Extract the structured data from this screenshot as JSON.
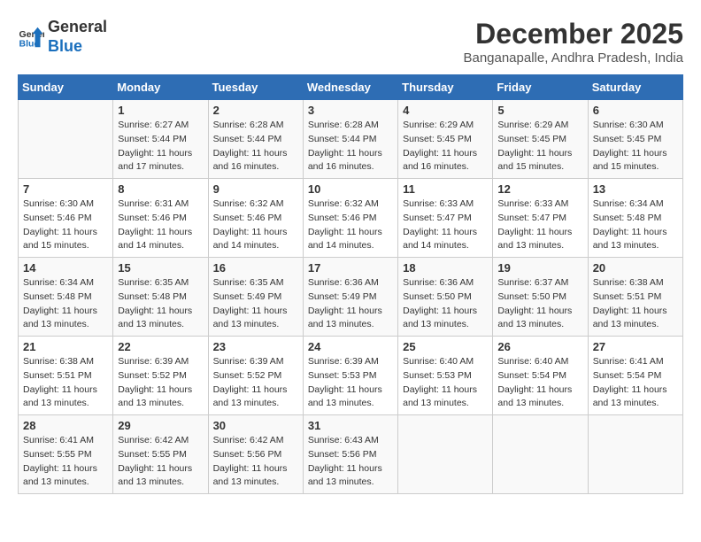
{
  "header": {
    "logo_line1": "General",
    "logo_line2": "Blue",
    "month": "December 2025",
    "location": "Banganapalle, Andhra Pradesh, India"
  },
  "days_of_week": [
    "Sunday",
    "Monday",
    "Tuesday",
    "Wednesday",
    "Thursday",
    "Friday",
    "Saturday"
  ],
  "weeks": [
    [
      {
        "day": "",
        "sunrise": "",
        "sunset": "",
        "daylight": ""
      },
      {
        "day": "1",
        "sunrise": "Sunrise: 6:27 AM",
        "sunset": "Sunset: 5:44 PM",
        "daylight": "Daylight: 11 hours and 17 minutes."
      },
      {
        "day": "2",
        "sunrise": "Sunrise: 6:28 AM",
        "sunset": "Sunset: 5:44 PM",
        "daylight": "Daylight: 11 hours and 16 minutes."
      },
      {
        "day": "3",
        "sunrise": "Sunrise: 6:28 AM",
        "sunset": "Sunset: 5:44 PM",
        "daylight": "Daylight: 11 hours and 16 minutes."
      },
      {
        "day": "4",
        "sunrise": "Sunrise: 6:29 AM",
        "sunset": "Sunset: 5:45 PM",
        "daylight": "Daylight: 11 hours and 16 minutes."
      },
      {
        "day": "5",
        "sunrise": "Sunrise: 6:29 AM",
        "sunset": "Sunset: 5:45 PM",
        "daylight": "Daylight: 11 hours and 15 minutes."
      },
      {
        "day": "6",
        "sunrise": "Sunrise: 6:30 AM",
        "sunset": "Sunset: 5:45 PM",
        "daylight": "Daylight: 11 hours and 15 minutes."
      }
    ],
    [
      {
        "day": "7",
        "sunrise": "Sunrise: 6:30 AM",
        "sunset": "Sunset: 5:46 PM",
        "daylight": "Daylight: 11 hours and 15 minutes."
      },
      {
        "day": "8",
        "sunrise": "Sunrise: 6:31 AM",
        "sunset": "Sunset: 5:46 PM",
        "daylight": "Daylight: 11 hours and 14 minutes."
      },
      {
        "day": "9",
        "sunrise": "Sunrise: 6:32 AM",
        "sunset": "Sunset: 5:46 PM",
        "daylight": "Daylight: 11 hours and 14 minutes."
      },
      {
        "day": "10",
        "sunrise": "Sunrise: 6:32 AM",
        "sunset": "Sunset: 5:46 PM",
        "daylight": "Daylight: 11 hours and 14 minutes."
      },
      {
        "day": "11",
        "sunrise": "Sunrise: 6:33 AM",
        "sunset": "Sunset: 5:47 PM",
        "daylight": "Daylight: 11 hours and 14 minutes."
      },
      {
        "day": "12",
        "sunrise": "Sunrise: 6:33 AM",
        "sunset": "Sunset: 5:47 PM",
        "daylight": "Daylight: 11 hours and 13 minutes."
      },
      {
        "day": "13",
        "sunrise": "Sunrise: 6:34 AM",
        "sunset": "Sunset: 5:48 PM",
        "daylight": "Daylight: 11 hours and 13 minutes."
      }
    ],
    [
      {
        "day": "14",
        "sunrise": "Sunrise: 6:34 AM",
        "sunset": "Sunset: 5:48 PM",
        "daylight": "Daylight: 11 hours and 13 minutes."
      },
      {
        "day": "15",
        "sunrise": "Sunrise: 6:35 AM",
        "sunset": "Sunset: 5:48 PM",
        "daylight": "Daylight: 11 hours and 13 minutes."
      },
      {
        "day": "16",
        "sunrise": "Sunrise: 6:35 AM",
        "sunset": "Sunset: 5:49 PM",
        "daylight": "Daylight: 11 hours and 13 minutes."
      },
      {
        "day": "17",
        "sunrise": "Sunrise: 6:36 AM",
        "sunset": "Sunset: 5:49 PM",
        "daylight": "Daylight: 11 hours and 13 minutes."
      },
      {
        "day": "18",
        "sunrise": "Sunrise: 6:36 AM",
        "sunset": "Sunset: 5:50 PM",
        "daylight": "Daylight: 11 hours and 13 minutes."
      },
      {
        "day": "19",
        "sunrise": "Sunrise: 6:37 AM",
        "sunset": "Sunset: 5:50 PM",
        "daylight": "Daylight: 11 hours and 13 minutes."
      },
      {
        "day": "20",
        "sunrise": "Sunrise: 6:38 AM",
        "sunset": "Sunset: 5:51 PM",
        "daylight": "Daylight: 11 hours and 13 minutes."
      }
    ],
    [
      {
        "day": "21",
        "sunrise": "Sunrise: 6:38 AM",
        "sunset": "Sunset: 5:51 PM",
        "daylight": "Daylight: 11 hours and 13 minutes."
      },
      {
        "day": "22",
        "sunrise": "Sunrise: 6:39 AM",
        "sunset": "Sunset: 5:52 PM",
        "daylight": "Daylight: 11 hours and 13 minutes."
      },
      {
        "day": "23",
        "sunrise": "Sunrise: 6:39 AM",
        "sunset": "Sunset: 5:52 PM",
        "daylight": "Daylight: 11 hours and 13 minutes."
      },
      {
        "day": "24",
        "sunrise": "Sunrise: 6:39 AM",
        "sunset": "Sunset: 5:53 PM",
        "daylight": "Daylight: 11 hours and 13 minutes."
      },
      {
        "day": "25",
        "sunrise": "Sunrise: 6:40 AM",
        "sunset": "Sunset: 5:53 PM",
        "daylight": "Daylight: 11 hours and 13 minutes."
      },
      {
        "day": "26",
        "sunrise": "Sunrise: 6:40 AM",
        "sunset": "Sunset: 5:54 PM",
        "daylight": "Daylight: 11 hours and 13 minutes."
      },
      {
        "day": "27",
        "sunrise": "Sunrise: 6:41 AM",
        "sunset": "Sunset: 5:54 PM",
        "daylight": "Daylight: 11 hours and 13 minutes."
      }
    ],
    [
      {
        "day": "28",
        "sunrise": "Sunrise: 6:41 AM",
        "sunset": "Sunset: 5:55 PM",
        "daylight": "Daylight: 11 hours and 13 minutes."
      },
      {
        "day": "29",
        "sunrise": "Sunrise: 6:42 AM",
        "sunset": "Sunset: 5:55 PM",
        "daylight": "Daylight: 11 hours and 13 minutes."
      },
      {
        "day": "30",
        "sunrise": "Sunrise: 6:42 AM",
        "sunset": "Sunset: 5:56 PM",
        "daylight": "Daylight: 11 hours and 13 minutes."
      },
      {
        "day": "31",
        "sunrise": "Sunrise: 6:43 AM",
        "sunset": "Sunset: 5:56 PM",
        "daylight": "Daylight: 11 hours and 13 minutes."
      },
      {
        "day": "",
        "sunrise": "",
        "sunset": "",
        "daylight": ""
      },
      {
        "day": "",
        "sunrise": "",
        "sunset": "",
        "daylight": ""
      },
      {
        "day": "",
        "sunrise": "",
        "sunset": "",
        "daylight": ""
      }
    ]
  ]
}
